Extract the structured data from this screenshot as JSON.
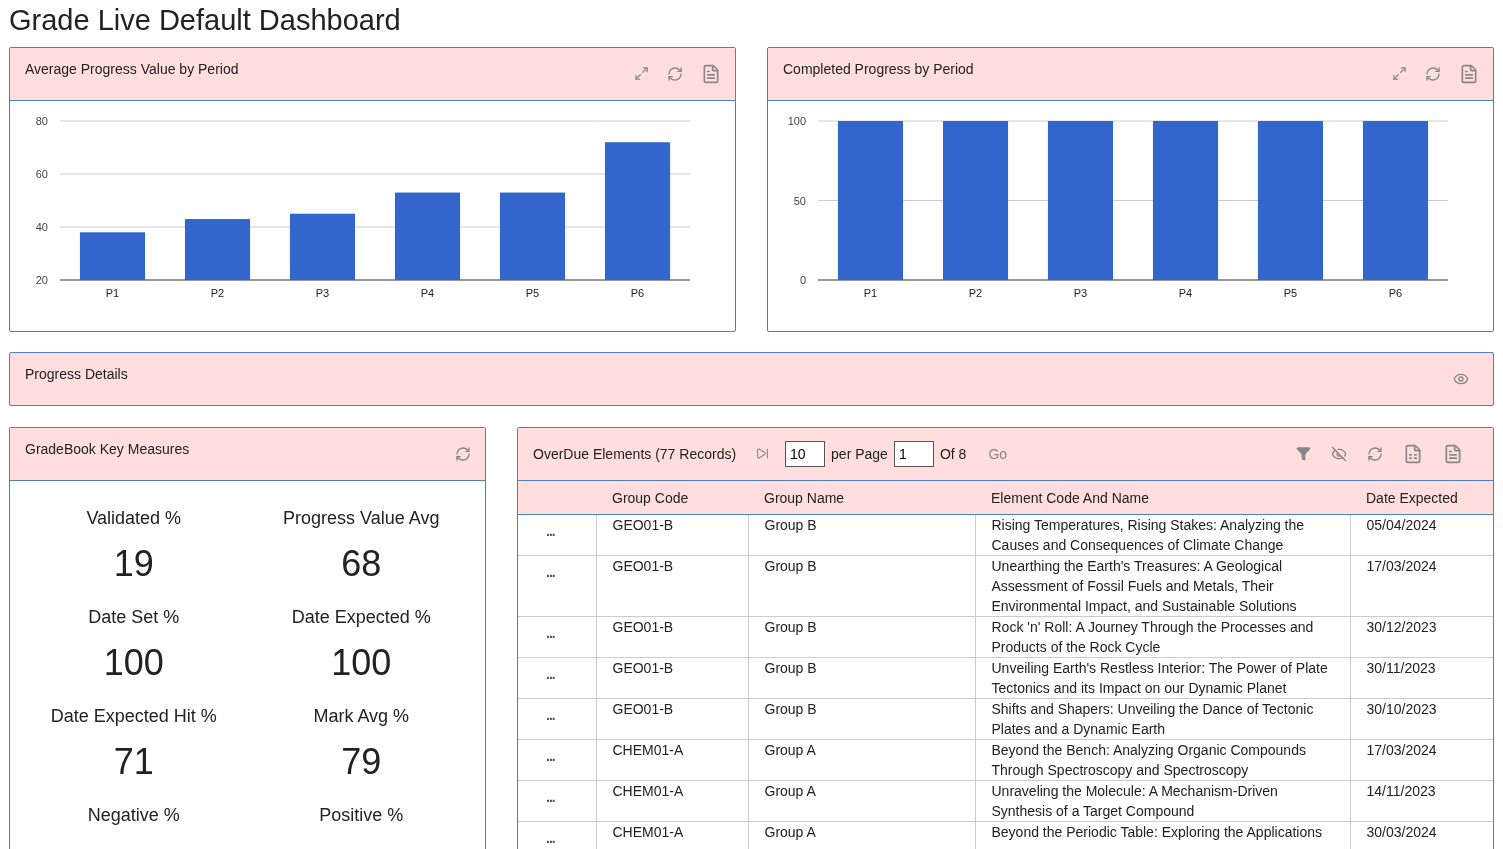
{
  "title": "Grade Live Default Dashboard",
  "charts": [
    {
      "title": "Average Progress Value by Period",
      "chart_data": {
        "type": "bar",
        "categories": [
          "P1",
          "P2",
          "P3",
          "P4",
          "P5",
          "P6"
        ],
        "values": [
          38,
          43,
          45,
          53,
          53,
          72
        ],
        "ylim": [
          20,
          80
        ],
        "yticks": [
          20,
          40,
          60,
          80
        ]
      }
    },
    {
      "title": "Completed Progress by Period",
      "chart_data": {
        "type": "bar",
        "categories": [
          "P1",
          "P2",
          "P3",
          "P4",
          "P5",
          "P6"
        ],
        "values": [
          100,
          100,
          100,
          100,
          100,
          100
        ],
        "ylim": [
          0,
          100
        ],
        "yticks": [
          0,
          50,
          100
        ]
      }
    }
  ],
  "progress_details": {
    "title": "Progress Details"
  },
  "key_measures": {
    "title": "GradeBook Key Measures",
    "measures": [
      {
        "label": "Validated %",
        "value": "19"
      },
      {
        "label": "Progress Value Avg",
        "value": "68"
      },
      {
        "label": "Date Set %",
        "value": "100"
      },
      {
        "label": "Date Expected %",
        "value": "100"
      },
      {
        "label": "Date Expected Hit %",
        "value": "71"
      },
      {
        "label": "Mark Avg %",
        "value": "79"
      },
      {
        "label": "Negative %"
      },
      {
        "label": "Positive %"
      }
    ]
  },
  "overdue": {
    "title": "OverDue Elements (77 Records)",
    "page_size": "10",
    "per_page_label": "per Page",
    "page": "1",
    "of_label": "Of 8",
    "go": "Go",
    "columns": [
      "Group Code",
      "Group Name",
      "Element Code And Name",
      "Date Expected"
    ],
    "rows": [
      {
        "menu": "...",
        "cells": [
          "GEO01-B",
          "Group B",
          "Rising Temperatures, Rising Stakes: Analyzing the Causes and Consequences of Climate Change",
          "05/04/2024"
        ]
      },
      {
        "menu": "...",
        "cells": [
          "GEO01-B",
          "Group B",
          "Unearthing the Earth's Treasures: A Geological Assessment of Fossil Fuels and Metals, Their Environmental Impact, and Sustainable Solutions",
          "17/03/2024"
        ]
      },
      {
        "menu": "...",
        "cells": [
          "GEO01-B",
          "Group B",
          "Rock 'n' Roll: A Journey Through the Processes and Products of the Rock Cycle",
          "30/12/2023"
        ]
      },
      {
        "menu": "...",
        "cells": [
          "GEO01-B",
          "Group B",
          "Unveiling Earth's Restless Interior: The Power of Plate Tectonics and its Impact on our Dynamic Planet",
          "30/11/2023"
        ]
      },
      {
        "menu": "...",
        "cells": [
          "GEO01-B",
          "Group B",
          "Shifts and Shapers: Unveiling the Dance of Tectonic Plates and a Dynamic Earth",
          "30/10/2023"
        ]
      },
      {
        "menu": "...",
        "cells": [
          "CHEM01-A",
          "Group A",
          "Beyond the Bench: Analyzing Organic Compounds Through Spectroscopy and Spectroscopy",
          "17/03/2024"
        ]
      },
      {
        "menu": "...",
        "cells": [
          "CHEM01-A",
          "Group A",
          "Unraveling the Molecule: A Mechanism-Driven Synthesis of a Target Compound",
          "14/11/2023"
        ]
      },
      {
        "menu": "...",
        "cells": [
          "CHEM01-A",
          "Group A",
          "Beyond the Periodic Table: Exploring the Applications",
          "30/03/2024"
        ]
      }
    ]
  }
}
